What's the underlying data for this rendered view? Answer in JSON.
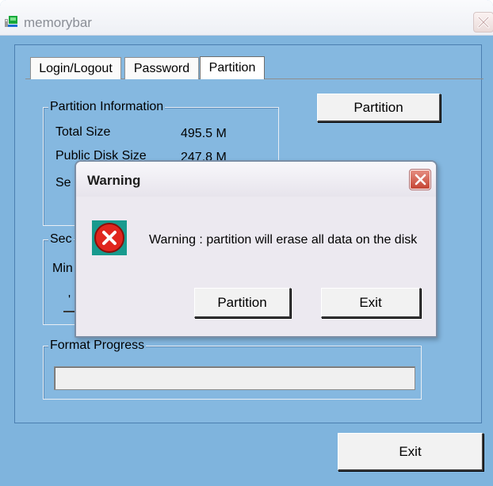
{
  "window": {
    "title": "memorybar"
  },
  "tabs": [
    {
      "label": "Login/Logout"
    },
    {
      "label": "Password"
    },
    {
      "label": "Partition",
      "active": true
    }
  ],
  "partition_info": {
    "legend": "Partition Information",
    "total_size_label": "Total Size",
    "total_size_value": "495.5 M",
    "public_disk_label": "Public Disk Size",
    "public_disk_value": "247.8 M",
    "secure_label_fragment": "Se"
  },
  "security_group": {
    "legend_fragment": "Sec",
    "min_label_fragment": "Min",
    "tick_fragment": "'"
  },
  "format_progress": {
    "legend": "Format Progress",
    "progress": 0
  },
  "buttons": {
    "partition": "Partition",
    "exit": "Exit"
  },
  "dialog": {
    "title": "Warning",
    "message": "Warning : partition will erase all data on the disk",
    "partition_button": "Partition",
    "exit_button": "Exit"
  },
  "colors": {
    "window_bg": "#7fb4dd",
    "panel_bg": "#85b8e0",
    "dialog_bg": "#ece9f0",
    "close_red": "#d0523f"
  }
}
